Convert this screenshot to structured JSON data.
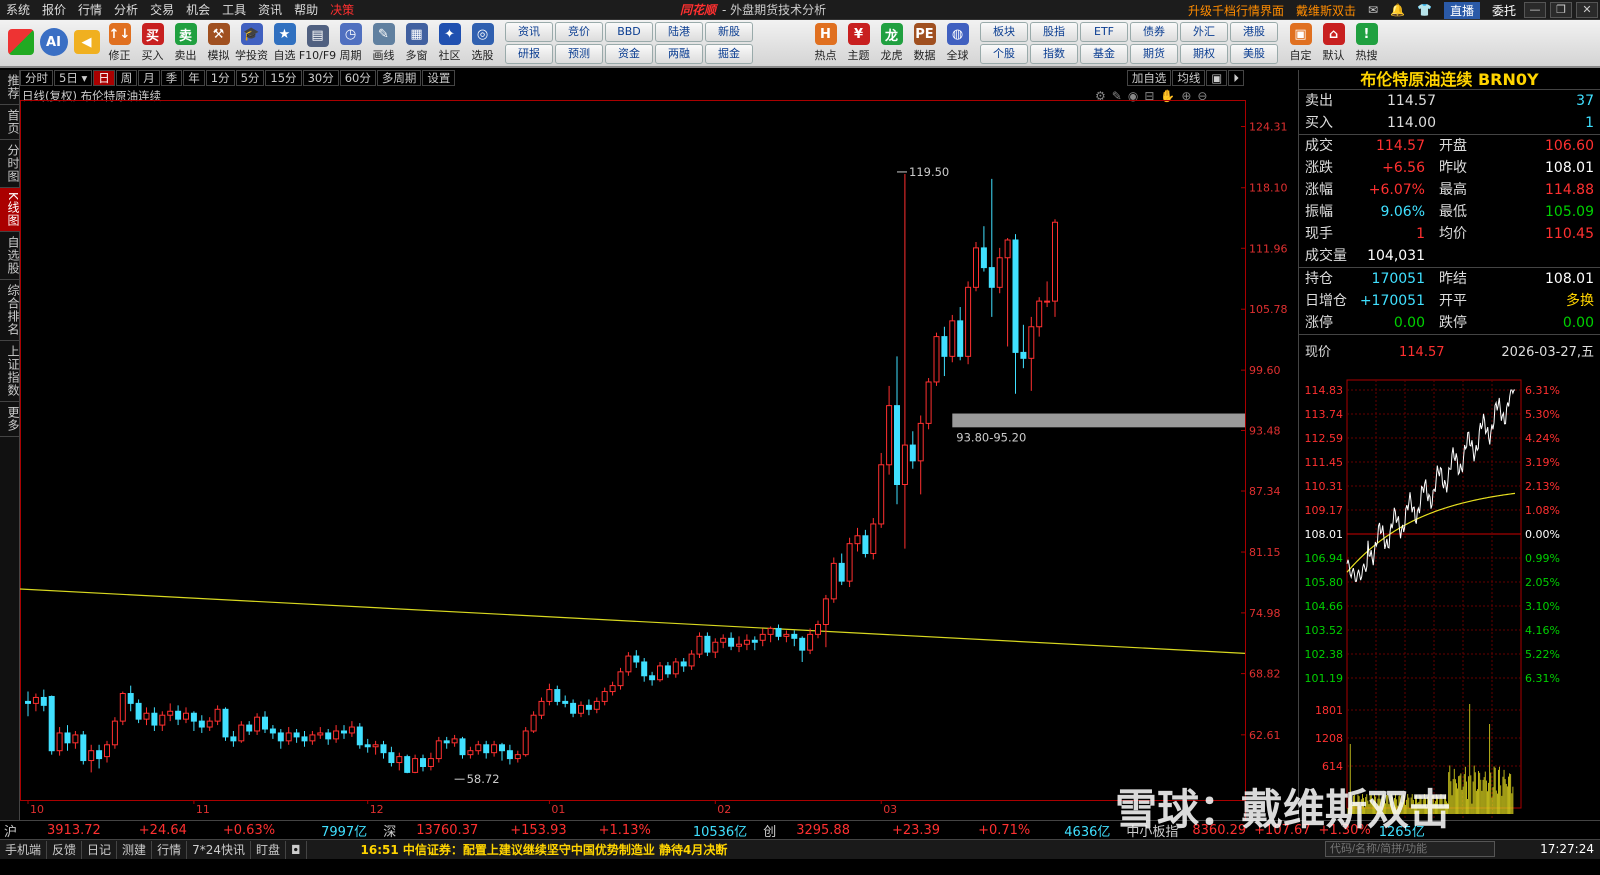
{
  "menubar": {
    "items": [
      "系统",
      "报价",
      "行情",
      "分析",
      "交易",
      "机会",
      "工具",
      "资讯",
      "帮助"
    ],
    "decision": "决策",
    "brand": "同花顺",
    "title": "- 外盘期货技术分析",
    "upgrade": "升级千档行情界面",
    "user": "戴维斯双击",
    "live": "直播",
    "delegate": "委托"
  },
  "toolbar": {
    "buttons": [
      {
        "label": "修正",
        "icon": "↑↓"
      },
      {
        "label": "买入",
        "icon": "买"
      },
      {
        "label": "卖出",
        "icon": "卖"
      },
      {
        "label": "模拟",
        "icon": "⚒"
      },
      {
        "label": "学投资",
        "icon": "🎓"
      },
      {
        "label": "自选",
        "icon": "★"
      },
      {
        "label": "F10/F9",
        "icon": "▤"
      },
      {
        "label": "周期",
        "icon": "◷"
      },
      {
        "label": "画线",
        "icon": "✎"
      },
      {
        "label": "多窗",
        "icon": "▦"
      },
      {
        "label": "社区",
        "icon": "✦"
      },
      {
        "label": "选股",
        "icon": "◎"
      }
    ],
    "grid": [
      "资讯",
      "竞价",
      "BBD",
      "陆港",
      "新股",
      "",
      "研报",
      "预测",
      "资金",
      "两融",
      "掘金",
      ""
    ],
    "buttons2": [
      {
        "label": "热点",
        "icon": "H"
      },
      {
        "label": "主题",
        "icon": "¥"
      },
      {
        "label": "龙虎",
        "icon": "龙"
      },
      {
        "label": "数据",
        "icon": "PE"
      },
      {
        "label": "全球",
        "icon": "◍"
      }
    ],
    "grid2": [
      "板块",
      "股指",
      "ETF",
      "债券",
      "外汇",
      "港股",
      "个股",
      "指数",
      "基金",
      "期货",
      "期权",
      "美股"
    ],
    "buttons3": [
      {
        "label": "自定",
        "icon": "▣"
      },
      {
        "label": "默认",
        "icon": "⌂"
      },
      {
        "label": "热搜",
        "icon": "!"
      }
    ]
  },
  "lefttabs": [
    "推荐",
    "首页",
    "分时图",
    "K线图",
    "自选股",
    "综合排名",
    "上证指数",
    "更多"
  ],
  "periods": [
    "分时",
    "5日",
    "日",
    "周",
    "月",
    "季",
    "年",
    "1分",
    "5分",
    "15分",
    "30分",
    "60分",
    "多周期",
    "设置"
  ],
  "active_period": "日",
  "period_right": [
    "加自选",
    "均线",
    "▣",
    "⏵"
  ],
  "chart_header": "日线(复权)  布伦特原油连续",
  "chart_data": {
    "type": "candlestick",
    "ylim": [
      56,
      127
    ],
    "y_ticks": [
      124.31,
      118.1,
      111.96,
      105.78,
      99.6,
      93.48,
      87.34,
      81.15,
      74.98,
      68.82,
      62.61
    ],
    "x_ticks": [
      {
        "label": "10",
        "i": 0
      },
      {
        "label": "11",
        "i": 21
      },
      {
        "label": "12",
        "i": 43
      },
      {
        "label": "01",
        "i": 66
      },
      {
        "label": "02",
        "i": 87
      },
      {
        "label": "03",
        "i": 108
      }
    ],
    "annotations": [
      {
        "text": "119.50",
        "i": 110,
        "v": 119.5,
        "pos": "above"
      },
      {
        "text": "58.72",
        "i": 54,
        "v": 58.72,
        "pos": "below"
      },
      {
        "text": "93.80-95.20",
        "type": "band",
        "i": 117,
        "lo": 93.8,
        "hi": 95.2
      }
    ],
    "trendline": {
      "from": {
        "i": 0,
        "v": 77.4
      },
      "to": {
        "i": 132,
        "v": 71.8
      }
    },
    "candles": [
      [
        66.0,
        65.8,
        64.5,
        67.0
      ],
      [
        65.8,
        66.4,
        65.0,
        66.8
      ],
      [
        66.4,
        65.6,
        65.0,
        67.2
      ],
      [
        66.5,
        61.0,
        60.6,
        66.6
      ],
      [
        61.0,
        62.8,
        60.5,
        63.4
      ],
      [
        62.8,
        61.8,
        61.0,
        63.6
      ],
      [
        61.8,
        62.6,
        61.2,
        63.0
      ],
      [
        62.6,
        60.0,
        59.6,
        63.0
      ],
      [
        60.0,
        61.0,
        58.8,
        61.6
      ],
      [
        61.0,
        60.2,
        59.2,
        61.6
      ],
      [
        60.4,
        61.6,
        59.8,
        62.0
      ],
      [
        61.6,
        64.0,
        61.2,
        64.4
      ],
      [
        64.0,
        66.8,
        63.6,
        67.0
      ],
      [
        66.8,
        65.8,
        65.0,
        67.6
      ],
      [
        65.8,
        64.2,
        63.8,
        66.2
      ],
      [
        64.2,
        64.8,
        63.6,
        65.4
      ],
      [
        64.8,
        63.6,
        63.0,
        65.4
      ],
      [
        63.6,
        64.6,
        63.0,
        65.0
      ],
      [
        64.6,
        65.0,
        64.0,
        65.8
      ],
      [
        65.0,
        64.2,
        63.6,
        65.6
      ],
      [
        64.2,
        64.8,
        63.8,
        65.4
      ],
      [
        64.8,
        64.0,
        63.0,
        65.0
      ],
      [
        64.0,
        63.4,
        62.8,
        64.6
      ],
      [
        63.4,
        64.0,
        63.0,
        64.4
      ],
      [
        64.0,
        65.2,
        63.6,
        65.6
      ],
      [
        65.2,
        62.4,
        62.0,
        65.4
      ],
      [
        62.4,
        62.0,
        61.4,
        63.0
      ],
      [
        62.0,
        63.6,
        61.8,
        64.0
      ],
      [
        63.6,
        63.0,
        62.6,
        64.0
      ],
      [
        63.0,
        64.4,
        62.6,
        64.8
      ],
      [
        64.4,
        63.2,
        62.8,
        65.0
      ],
      [
        63.2,
        62.8,
        62.2,
        63.6
      ],
      [
        62.8,
        62.0,
        61.2,
        63.2
      ],
      [
        62.0,
        62.8,
        61.6,
        63.4
      ],
      [
        62.8,
        62.4,
        61.8,
        63.2
      ],
      [
        62.4,
        62.0,
        61.4,
        63.0
      ],
      [
        62.0,
        62.6,
        61.6,
        63.0
      ],
      [
        62.6,
        62.8,
        62.2,
        63.4
      ],
      [
        62.8,
        62.2,
        61.6,
        63.2
      ],
      [
        62.2,
        63.0,
        61.8,
        63.6
      ],
      [
        63.0,
        62.8,
        62.2,
        63.6
      ],
      [
        62.8,
        63.4,
        62.4,
        64.0
      ],
      [
        63.4,
        61.6,
        61.2,
        63.8
      ],
      [
        61.6,
        61.4,
        60.8,
        62.2
      ],
      [
        61.4,
        61.6,
        60.6,
        62.0
      ],
      [
        61.6,
        60.8,
        60.2,
        62.0
      ],
      [
        60.8,
        59.8,
        59.4,
        61.4
      ],
      [
        59.8,
        60.4,
        59.0,
        60.8
      ],
      [
        60.4,
        58.8,
        58.72,
        60.6
      ],
      [
        58.8,
        60.2,
        58.72,
        60.6
      ],
      [
        60.2,
        59.4,
        58.9,
        60.6
      ],
      [
        59.4,
        60.2,
        59.0,
        60.8
      ],
      [
        60.2,
        62.0,
        59.8,
        62.4
      ],
      [
        62.0,
        61.8,
        61.2,
        62.4
      ],
      [
        61.8,
        62.2,
        61.4,
        62.6
      ],
      [
        62.2,
        60.6,
        60.2,
        62.4
      ],
      [
        60.6,
        61.0,
        60.2,
        61.4
      ],
      [
        61.0,
        61.6,
        60.6,
        62.0
      ],
      [
        61.6,
        60.8,
        60.2,
        62.0
      ],
      [
        60.8,
        61.6,
        60.4,
        62.0
      ],
      [
        61.6,
        61.0,
        60.0,
        61.8
      ],
      [
        61.0,
        60.2,
        59.6,
        61.6
      ],
      [
        60.2,
        60.6,
        59.8,
        61.0
      ],
      [
        60.6,
        63.0,
        60.4,
        63.4
      ],
      [
        63.0,
        64.6,
        62.8,
        65.0
      ],
      [
        64.6,
        66.0,
        64.2,
        66.4
      ],
      [
        66.0,
        67.2,
        65.6,
        67.8
      ],
      [
        67.2,
        66.0,
        65.6,
        67.6
      ],
      [
        66.0,
        65.8,
        65.4,
        66.6
      ],
      [
        65.8,
        64.8,
        64.4,
        66.2
      ],
      [
        64.8,
        65.6,
        64.4,
        66.0
      ],
      [
        65.6,
        65.2,
        64.6,
        66.2
      ],
      [
        65.2,
        66.0,
        64.8,
        66.4
      ],
      [
        66.0,
        67.0,
        65.6,
        67.4
      ],
      [
        67.0,
        67.6,
        66.6,
        68.0
      ],
      [
        67.6,
        69.0,
        67.2,
        69.4
      ],
      [
        69.0,
        70.6,
        68.6,
        71.0
      ],
      [
        70.6,
        70.0,
        69.4,
        71.2
      ],
      [
        70.0,
        68.6,
        68.0,
        70.4
      ],
      [
        68.6,
        68.2,
        67.6,
        69.0
      ],
      [
        68.2,
        69.6,
        68.0,
        70.0
      ],
      [
        69.6,
        68.8,
        68.4,
        70.0
      ],
      [
        68.8,
        70.0,
        68.4,
        70.4
      ],
      [
        70.0,
        69.6,
        69.0,
        70.4
      ],
      [
        69.6,
        70.8,
        69.2,
        71.2
      ],
      [
        70.8,
        72.6,
        70.4,
        73.0
      ],
      [
        72.6,
        71.0,
        70.6,
        73.0
      ],
      [
        71.0,
        72.0,
        70.4,
        72.4
      ],
      [
        72.0,
        72.4,
        71.4,
        72.8
      ],
      [
        72.4,
        71.6,
        71.2,
        73.0
      ],
      [
        71.6,
        71.8,
        71.0,
        72.6
      ],
      [
        71.8,
        72.2,
        71.2,
        72.8
      ],
      [
        72.2,
        72.0,
        71.2,
        72.6
      ]
    ]
  },
  "right": {
    "title": "布伦特原油连续 BRN0Y",
    "ask": {
      "label": "卖出",
      "price": "114.57",
      "vol": "37"
    },
    "bid": {
      "label": "买入",
      "price": "114.00",
      "vol": "1"
    },
    "quote": [
      {
        "l1": "成交",
        "v1": "114.57",
        "c1": "red",
        "l2": "开盘",
        "v2": "106.60",
        "c2": "red"
      },
      {
        "l1": "涨跌",
        "v1": "+6.56",
        "c1": "red",
        "l2": "昨收",
        "v2": "108.01",
        "c2": "white"
      },
      {
        "l1": "涨幅",
        "v1": "+6.07%",
        "c1": "red",
        "l2": "最高",
        "v2": "114.88",
        "c2": "red"
      },
      {
        "l1": "振幅",
        "v1": "9.06%",
        "c1": "cyan",
        "l2": "最低",
        "v2": "105.09",
        "c2": "green"
      },
      {
        "l1": "现手",
        "v1": "1",
        "c1": "red",
        "l2": "均价",
        "v2": "110.45",
        "c2": "red"
      },
      {
        "l1": "成交量",
        "v1": "104,031",
        "c1": "white",
        "l2": "",
        "v2": "",
        "c2": "white"
      }
    ],
    "position": [
      {
        "l1": "持仓",
        "v1": "170051",
        "c1": "cyan",
        "l2": "昨结",
        "v2": "108.01",
        "c2": "white"
      },
      {
        "l1": "日增仓",
        "v1": "+170051",
        "c1": "cyan",
        "l2": "开平",
        "v2": "多换",
        "c2": "yel"
      },
      {
        "l1": "涨停",
        "v1": "0.00",
        "c1": "green",
        "l2": "跌停",
        "v2": "0.00",
        "c2": "green"
      }
    ],
    "now_label": "现价",
    "now_price": "114.57",
    "date": "2026-03-27,五",
    "mini": {
      "price_ticks": [
        "114.83",
        "113.74",
        "112.59",
        "111.45",
        "110.31",
        "109.17",
        "108.01",
        "106.94",
        "105.80",
        "104.66",
        "103.52",
        "102.38",
        "101.19"
      ],
      "pct_ticks": [
        "6.31%",
        "5.30%",
        "4.24%",
        "3.19%",
        "2.13%",
        "1.08%",
        "0.00%",
        "0.99%",
        "2.05%",
        "3.10%",
        "4.16%",
        "5.22%",
        "6.31%"
      ],
      "vol_ticks": [
        "1801",
        "1208",
        "614"
      ]
    }
  },
  "status": {
    "sh_label": "沪",
    "sh": "3913.72",
    "sh_chg": "+24.64",
    "sh_pct": "+0.63%",
    "sh_amt": "7997亿",
    "sz_label": "深",
    "sz": "13760.37",
    "sz_chg": "+153.93",
    "sz_pct": "+1.13%",
    "sz_amt": "10536亿",
    "cy_label": "创",
    "cy": "3295.88",
    "cy_chg": "+23.39",
    "cy_pct": "+0.71%",
    "cy_amt": "4636亿",
    "zx_label": "中小板指",
    "zx": "8360.29",
    "zx_chg": "+107.67",
    "zx_pct": "+1.30%",
    "zx_amt": "1265亿"
  },
  "bottom": {
    "tabs": [
      "手机端",
      "反馈",
      "日记",
      "测建",
      "行情",
      "7*24快讯",
      "盯盘"
    ],
    "news": "16:51 中信证券：配置上建议继续坚守中国优势制造业 静待4月决断",
    "search_placeholder": "代码/名称/简拼/功能",
    "clock": "17:27:24"
  },
  "watermark": "雪球：戴维斯双击"
}
